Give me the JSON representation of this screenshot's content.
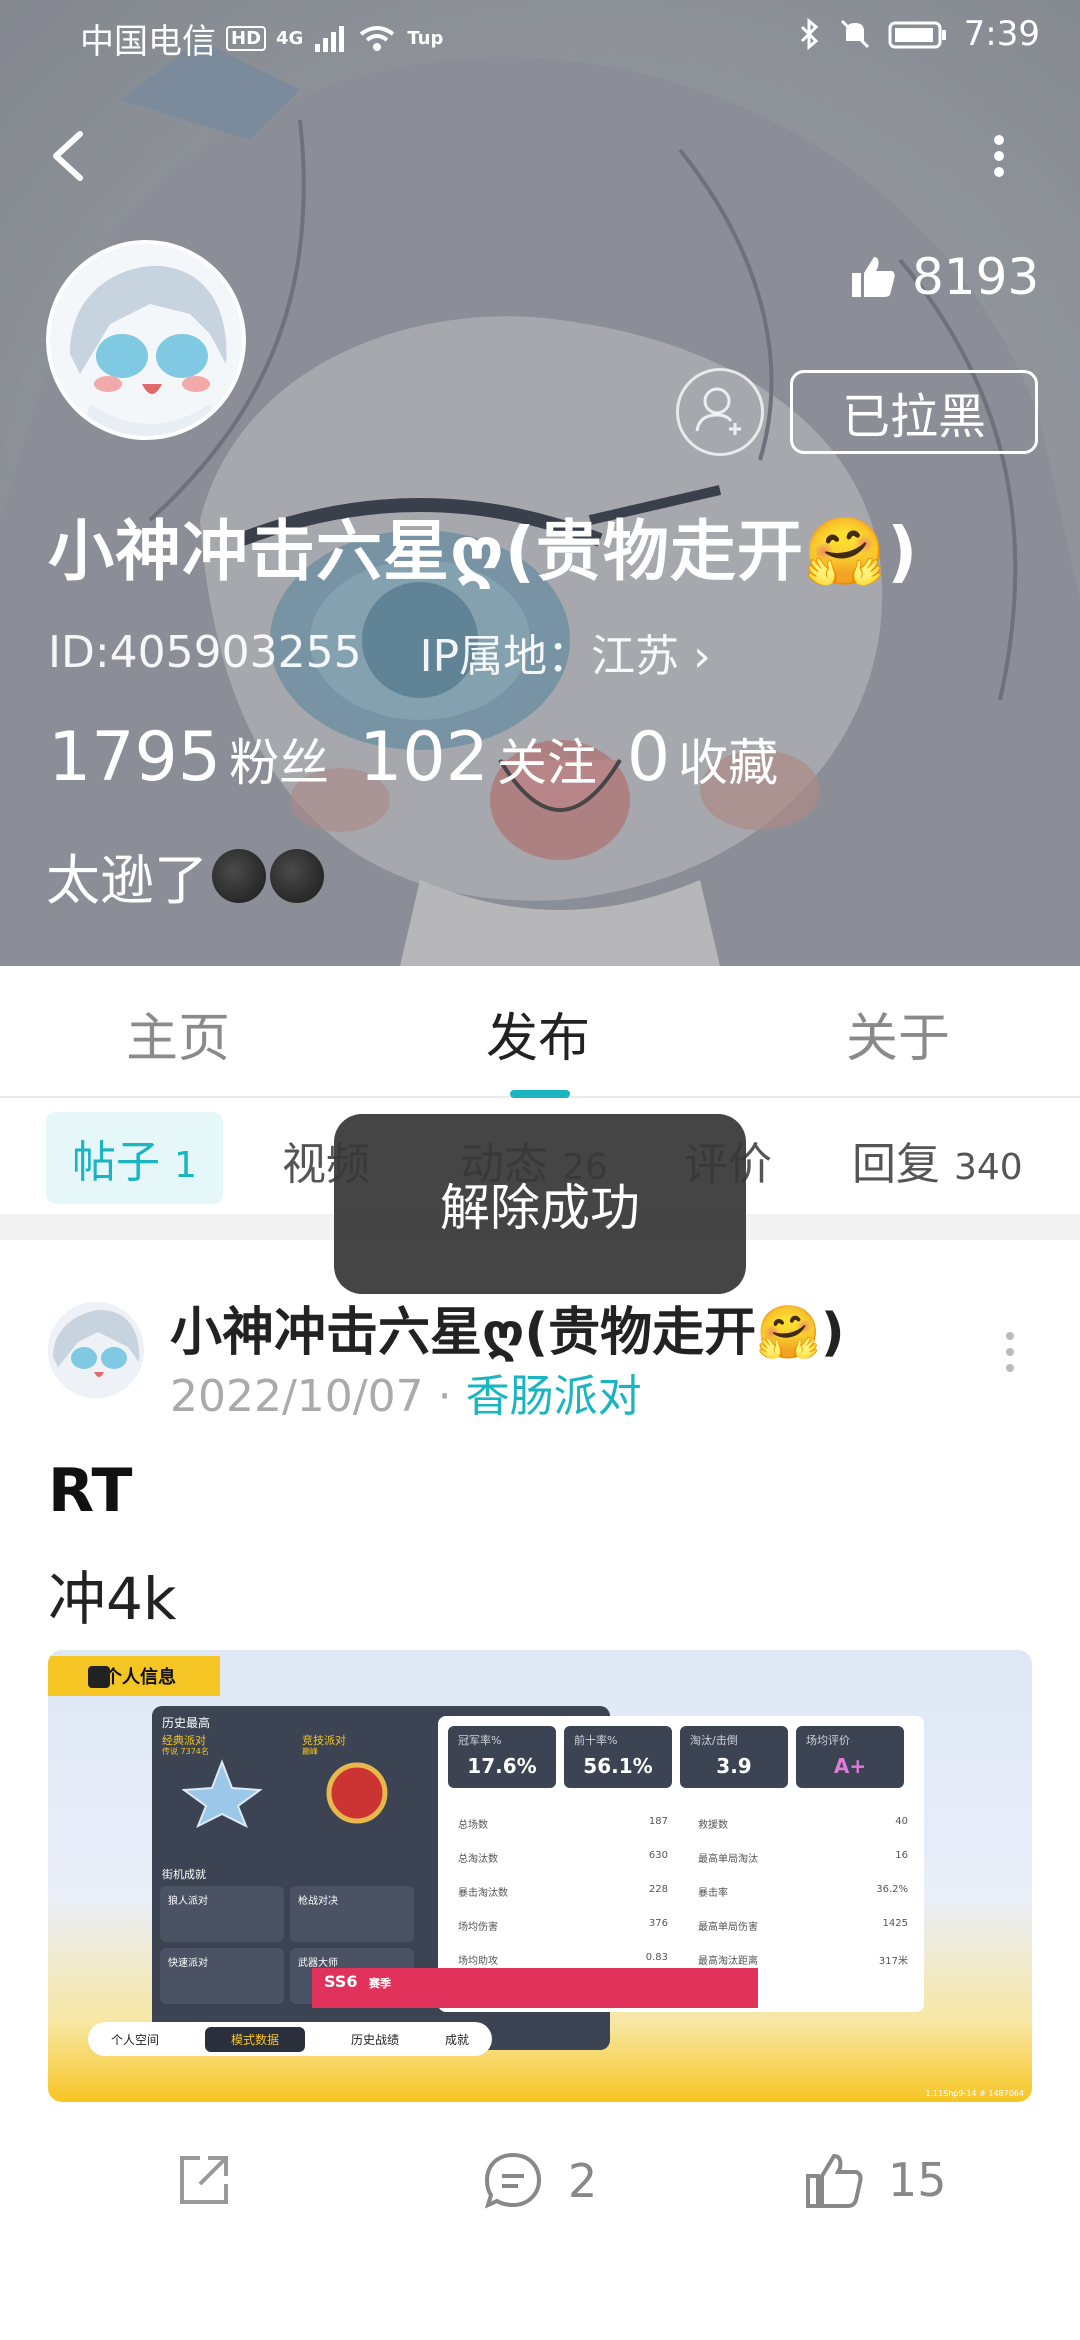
{
  "status_bar": {
    "carrier": "中国电信",
    "hd_badge": "HD",
    "net": "4G",
    "wifi_speed": "Tup",
    "time": "7:39"
  },
  "profile": {
    "likes": "8193",
    "blocked_label": "已拉黑",
    "nickname": "小神冲击六星ღ(贵物走开🤗)",
    "id_text": "ID:405903255",
    "ip_text": "IP属地：江苏 ›",
    "stats": [
      {
        "num": "1795",
        "label": "粉丝"
      },
      {
        "num": "102",
        "label": "关注"
      },
      {
        "num": "0",
        "label": "收藏"
      }
    ],
    "bio": "太逊了"
  },
  "tabs": [
    "主页",
    "发布",
    "关于"
  ],
  "subtabs": [
    {
      "label": "帖子",
      "count": "1"
    },
    {
      "label": "视频",
      "count": ""
    },
    {
      "label": "动态",
      "count": "26"
    },
    {
      "label": "评价",
      "count": ""
    },
    {
      "label": "回复",
      "count": "340"
    }
  ],
  "toast": "解除成功",
  "post": {
    "author": "小神冲击六星ღ(贵物走开🤗)",
    "date": "2022/10/07",
    "separator": "·",
    "tag": "香肠派对",
    "title": "RT",
    "body": "冲4k",
    "image": {
      "header_tab": "个人信息",
      "left_title": "历史最高",
      "mode1": "经典派对",
      "mode1_sub": "传说 7374名",
      "mode2": "竞技派对",
      "mode2_sub": "巅峰",
      "arcade": "街机成就",
      "arcade_items": [
        "狼人派对",
        "枪战对决",
        "快速派对",
        "武器大师"
      ],
      "cards": [
        {
          "k": "冠军率%",
          "v": "17.6%"
        },
        {
          "k": "前十率%",
          "v": "56.1%"
        },
        {
          "k": "淘汰/击倒",
          "v": "3.9"
        },
        {
          "k": "场均评价",
          "v": "A+"
        }
      ],
      "rows_left": [
        {
          "k": "总场数",
          "v": "187"
        },
        {
          "k": "总淘汰数",
          "v": "630"
        },
        {
          "k": "暴击淘汰数",
          "v": "228"
        },
        {
          "k": "场均伤害",
          "v": "376"
        },
        {
          "k": "场均助攻",
          "v": "0.83"
        }
      ],
      "rows_right": [
        {
          "k": "救援数",
          "v": "40"
        },
        {
          "k": "最高单局淘汰",
          "v": "16"
        },
        {
          "k": "暴击率",
          "v": "36.2%"
        },
        {
          "k": "最高单局伤害",
          "v": "1425"
        },
        {
          "k": "最高淘汰距离",
          "v": "317米"
        }
      ],
      "season": "SS6",
      "season_sub": "赛季",
      "bottom_tabs": [
        "个人空间",
        "模式数据",
        "历史战绩",
        "成就"
      ],
      "uid": "1.11Shp9-14 # 1487064"
    },
    "comments": "2",
    "likes": "15"
  },
  "colors": {
    "accent": "#1ab5c1",
    "toast_bg": "#373737",
    "game_yellow": "#f5c623"
  }
}
